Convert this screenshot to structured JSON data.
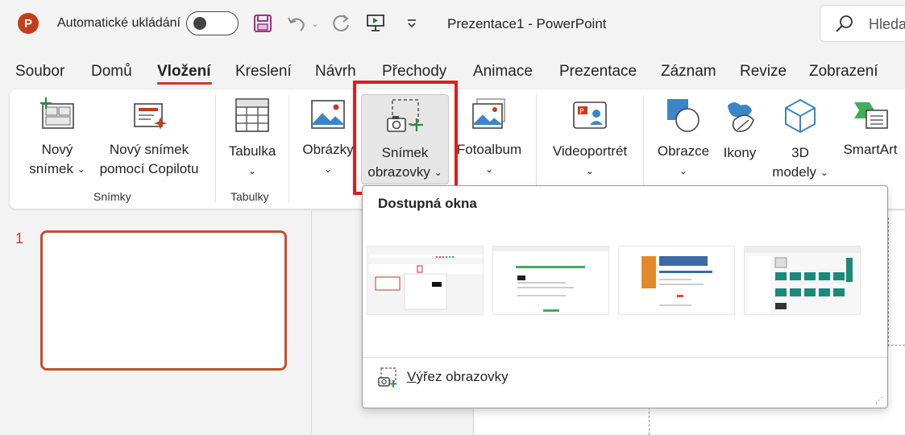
{
  "titlebar": {
    "app_logo_letter": "P",
    "autosave_label": "Automatické ukládání",
    "autosave_on": false,
    "document_title": "Prezentace1  -  PowerPoint",
    "search_placeholder": "Hleda"
  },
  "tabs": [
    {
      "label": "Soubor",
      "active": false
    },
    {
      "label": "Domů",
      "active": false
    },
    {
      "label": "Vložení",
      "active": true
    },
    {
      "label": "Kreslení",
      "active": false
    },
    {
      "label": "Návrh",
      "active": false
    },
    {
      "label": "Přechody",
      "active": false
    },
    {
      "label": "Animace",
      "active": false
    },
    {
      "label": "Prezentace",
      "active": false
    },
    {
      "label": "Záznam",
      "active": false
    },
    {
      "label": "Revize",
      "active": false
    },
    {
      "label": "Zobrazení",
      "active": false
    }
  ],
  "ribbon": {
    "new_slide": {
      "line1": "Nový",
      "line2": "snímek"
    },
    "new_slide_copilot": {
      "line1": "Nový snímek",
      "line2": "pomocí Copilotu"
    },
    "group_slides": "Snímky",
    "table": {
      "line1": "Tabulka"
    },
    "group_tables": "Tabulky",
    "pictures": {
      "line1": "Obrázky"
    },
    "screenshot": {
      "line1": "Snímek",
      "line2": "obrazovky"
    },
    "photo_album": {
      "line1": "Fotoalbum"
    },
    "video_portrait": {
      "line1": "Videoportrét"
    },
    "shapes": {
      "line1": "Obrazce"
    },
    "icons": {
      "line1": "Ikony"
    },
    "models3d": {
      "line1": "3D",
      "line2": "modely"
    },
    "smartart": {
      "line1": "SmartArt"
    }
  },
  "slides_pane": {
    "slide_number": "1"
  },
  "dropdown": {
    "heading": "Dostupná okna",
    "windows": [
      "window-1",
      "window-2",
      "window-3",
      "window-4"
    ],
    "clip_accel": "V",
    "clip_rest": "ýřez obrazovky"
  },
  "colors": {
    "accent": "#c43e1c",
    "highlight_frame": "#e01c1c",
    "ribbon_bg": "#ffffff",
    "window_bg": "#f3f3f3"
  }
}
